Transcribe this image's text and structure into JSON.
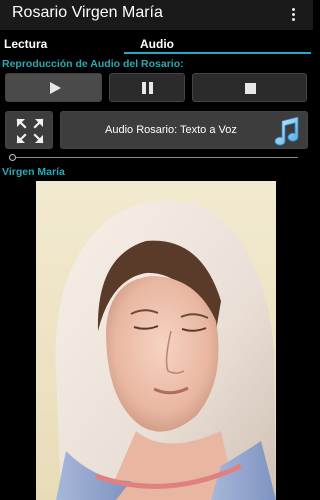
{
  "appbar": {
    "title": "Rosario Virgen María",
    "menu_icon": "more-vert-icon"
  },
  "tabs": [
    {
      "label": "Lectura",
      "selected": false
    },
    {
      "label": "Audio",
      "selected": true
    }
  ],
  "audio_section": {
    "label": "Reproducción de Audio del Rosario:",
    "play_icon": "play-icon",
    "pause_icon": "pause-icon",
    "stop_icon": "stop-icon",
    "fullscreen_icon": "fullscreen-icon",
    "rosario_button_label": "Audio Rosario: Texto a Voz",
    "music_icon": "music-note-icon",
    "seek_progress": 0
  },
  "image_section": {
    "label": "Virgen María"
  },
  "colors": {
    "accent": "#2aa9b5",
    "tab_indicator": "#26a8c9",
    "appbar": "#1a1a1a",
    "background": "#000000"
  }
}
